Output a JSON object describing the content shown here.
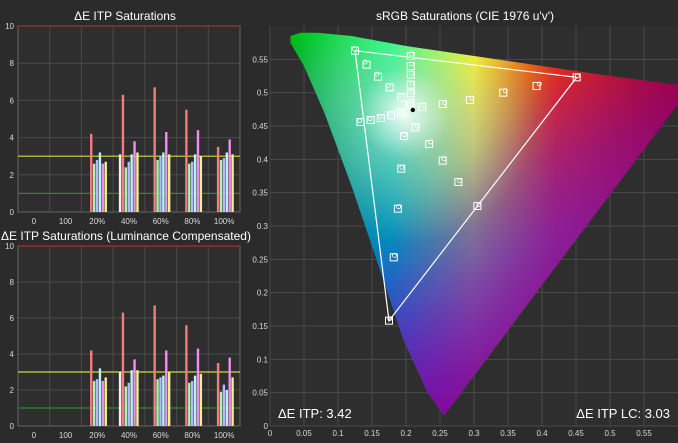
{
  "panels": {
    "top_title": "ΔE ITP Saturations",
    "bottom_title": "ΔE ITP Saturations (Luminance Compensated)",
    "right_title": "sRGB Saturations (CIE 1976 u'v')"
  },
  "stats": {
    "de_itp": "ΔE ITP: 3.42",
    "de_itp_lc": "ΔE ITP LC: 3.03"
  },
  "colors": {
    "background": "#2b2b2b",
    "plot_bg": "#2e2e2e",
    "grid": "#4a4a4a",
    "red_line": "#a83030",
    "yellow_line": "#d6d640",
    "green_line": "#2a8a2a"
  },
  "chart_data": [
    {
      "type": "bar",
      "title": "ΔE ITP Saturations",
      "ylim": [
        0,
        10
      ],
      "yticks": [
        0,
        2,
        4,
        6,
        8,
        10
      ],
      "xtick_labels": [
        "0",
        "100",
        "20%",
        "40%",
        "60%",
        "80%",
        "100%"
      ],
      "reference_lines": [
        {
          "y": 10,
          "color": "red"
        },
        {
          "y": 3,
          "color": "yellow"
        },
        {
          "y": 1,
          "color": "green"
        }
      ],
      "groups": [
        {
          "name": "white",
          "values": [
            0,
            0,
            0,
            3.1,
            0,
            0,
            0
          ]
        },
        {
          "name": "red",
          "values": [
            0,
            0,
            4.2,
            6.3,
            6.7,
            5.5,
            3.5
          ]
        },
        {
          "name": "green",
          "values": [
            0,
            0,
            2.6,
            2.4,
            2.8,
            2.6,
            2.8
          ]
        },
        {
          "name": "blue",
          "values": [
            0,
            0,
            2.8,
            2.7,
            3.0,
            2.7,
            2.9
          ]
        },
        {
          "name": "cyan",
          "values": [
            0,
            0,
            3.2,
            3.1,
            3.2,
            3.1,
            3.2
          ]
        },
        {
          "name": "magenta",
          "values": [
            0,
            0,
            2.6,
            3.8,
            4.3,
            4.4,
            3.9
          ]
        },
        {
          "name": "yellow",
          "values": [
            0,
            0,
            2.7,
            3.2,
            3.1,
            3.0,
            3.1
          ]
        }
      ]
    },
    {
      "type": "bar",
      "title": "ΔE ITP Saturations (Luminance Compensated)",
      "ylim": [
        0,
        10
      ],
      "yticks": [
        0,
        2,
        4,
        6,
        8,
        10
      ],
      "xtick_labels": [
        "0",
        "100",
        "20%",
        "40%",
        "60%",
        "80%",
        "100%"
      ],
      "reference_lines": [
        {
          "y": 10,
          "color": "red"
        },
        {
          "y": 3,
          "color": "yellow"
        },
        {
          "y": 1,
          "color": "green"
        }
      ],
      "groups": [
        {
          "name": "white",
          "values": [
            0,
            0,
            0,
            3.0,
            0,
            0,
            0
          ]
        },
        {
          "name": "red",
          "values": [
            0,
            0,
            4.2,
            6.3,
            6.7,
            5.6,
            3.5
          ]
        },
        {
          "name": "green",
          "values": [
            0,
            0,
            2.5,
            2.2,
            2.6,
            2.4,
            1.9
          ]
        },
        {
          "name": "blue",
          "values": [
            0,
            0,
            2.6,
            2.4,
            2.7,
            2.5,
            2.3
          ]
        },
        {
          "name": "cyan",
          "values": [
            0,
            0,
            3.2,
            3.1,
            2.8,
            2.8,
            2.0
          ]
        },
        {
          "name": "magenta",
          "values": [
            0,
            0,
            2.5,
            3.7,
            4.2,
            4.3,
            3.8
          ]
        },
        {
          "name": "yellow",
          "values": [
            0,
            0,
            2.7,
            3.1,
            3.0,
            2.9,
            2.7
          ]
        }
      ]
    },
    {
      "type": "scatter",
      "title": "sRGB Saturations (CIE 1976 u'v')",
      "xlabel": "",
      "ylabel": "",
      "xlim": [
        0,
        0.6
      ],
      "ylim": [
        0,
        0.6
      ],
      "xticks": [
        0,
        0.05,
        0.1,
        0.15,
        0.2,
        0.25,
        0.3,
        0.35,
        0.4,
        0.45,
        0.5,
        0.55
      ],
      "yticks": [
        0,
        0.05,
        0.1,
        0.15,
        0.2,
        0.25,
        0.3,
        0.35,
        0.4,
        0.45,
        0.5,
        0.55
      ],
      "gamut_triangle": [
        [
          0.451,
          0.523
        ],
        [
          0.125,
          0.563
        ],
        [
          0.175,
          0.158
        ]
      ],
      "white_point": [
        0.1978,
        0.4683
      ],
      "measured_point": [
        0.21,
        0.474
      ],
      "targets": [
        {
          "series": "red",
          "points": [
            [
              0.224,
              0.479
            ],
            [
              0.254,
              0.483
            ],
            [
              0.294,
              0.489
            ],
            [
              0.343,
              0.5
            ],
            [
              0.392,
              0.51
            ],
            [
              0.451,
              0.523
            ]
          ]
        },
        {
          "series": "green",
          "points": [
            [
              0.205,
              0.481
            ],
            [
              0.193,
              0.493
            ],
            [
              0.176,
              0.508
            ],
            [
              0.159,
              0.524
            ],
            [
              0.142,
              0.542
            ],
            [
              0.125,
              0.563
            ]
          ]
        },
        {
          "series": "blue",
          "points": [
            [
              0.197,
              0.435
            ],
            [
              0.193,
              0.386
            ],
            [
              0.188,
              0.326
            ],
            [
              0.182,
              0.253
            ],
            [
              0.175,
              0.158
            ]
          ]
        },
        {
          "series": "cyan",
          "points": [
            [
              0.192,
              0.47
            ],
            [
              0.178,
              0.466
            ],
            [
              0.163,
              0.462
            ],
            [
              0.148,
              0.459
            ],
            [
              0.133,
              0.456
            ]
          ]
        },
        {
          "series": "magenta",
          "points": [
            [
              0.214,
              0.448
            ],
            [
              0.234,
              0.423
            ],
            [
              0.254,
              0.398
            ],
            [
              0.277,
              0.366
            ],
            [
              0.305,
              0.33
            ]
          ]
        },
        {
          "series": "yellow",
          "points": [
            [
              0.207,
              0.485
            ],
            [
              0.207,
              0.499
            ],
            [
              0.207,
              0.512
            ],
            [
              0.207,
              0.527
            ],
            [
              0.207,
              0.54
            ],
            [
              0.207,
              0.555
            ]
          ]
        }
      ],
      "measured": [
        {
          "series": "red",
          "points": [
            [
              0.226,
              0.481
            ],
            [
              0.257,
              0.485
            ],
            [
              0.297,
              0.492
            ],
            [
              0.346,
              0.503
            ],
            [
              0.396,
              0.513
            ],
            [
              0.452,
              0.525
            ]
          ]
        },
        {
          "series": "green",
          "points": [
            [
              0.204,
              0.483
            ],
            [
              0.191,
              0.496
            ],
            [
              0.174,
              0.511
            ],
            [
              0.157,
              0.528
            ],
            [
              0.14,
              0.546
            ],
            [
              0.124,
              0.566
            ]
          ]
        },
        {
          "series": "blue",
          "points": [
            [
              0.198,
              0.437
            ],
            [
              0.194,
              0.388
            ],
            [
              0.189,
              0.329
            ],
            [
              0.183,
              0.256
            ],
            [
              0.176,
              0.161
            ]
          ]
        },
        {
          "series": "cyan",
          "points": [
            [
              0.191,
              0.472
            ],
            [
              0.177,
              0.468
            ],
            [
              0.162,
              0.464
            ],
            [
              0.147,
              0.461
            ],
            [
              0.132,
              0.458
            ]
          ]
        },
        {
          "series": "magenta",
          "points": [
            [
              0.216,
              0.45
            ],
            [
              0.236,
              0.426
            ],
            [
              0.256,
              0.401
            ],
            [
              0.279,
              0.368
            ],
            [
              0.307,
              0.332
            ]
          ]
        },
        {
          "series": "yellow",
          "points": [
            [
              0.208,
              0.487
            ],
            [
              0.208,
              0.501
            ],
            [
              0.208,
              0.514
            ],
            [
              0.208,
              0.529
            ],
            [
              0.208,
              0.543
            ],
            [
              0.208,
              0.558
            ]
          ]
        }
      ]
    }
  ]
}
